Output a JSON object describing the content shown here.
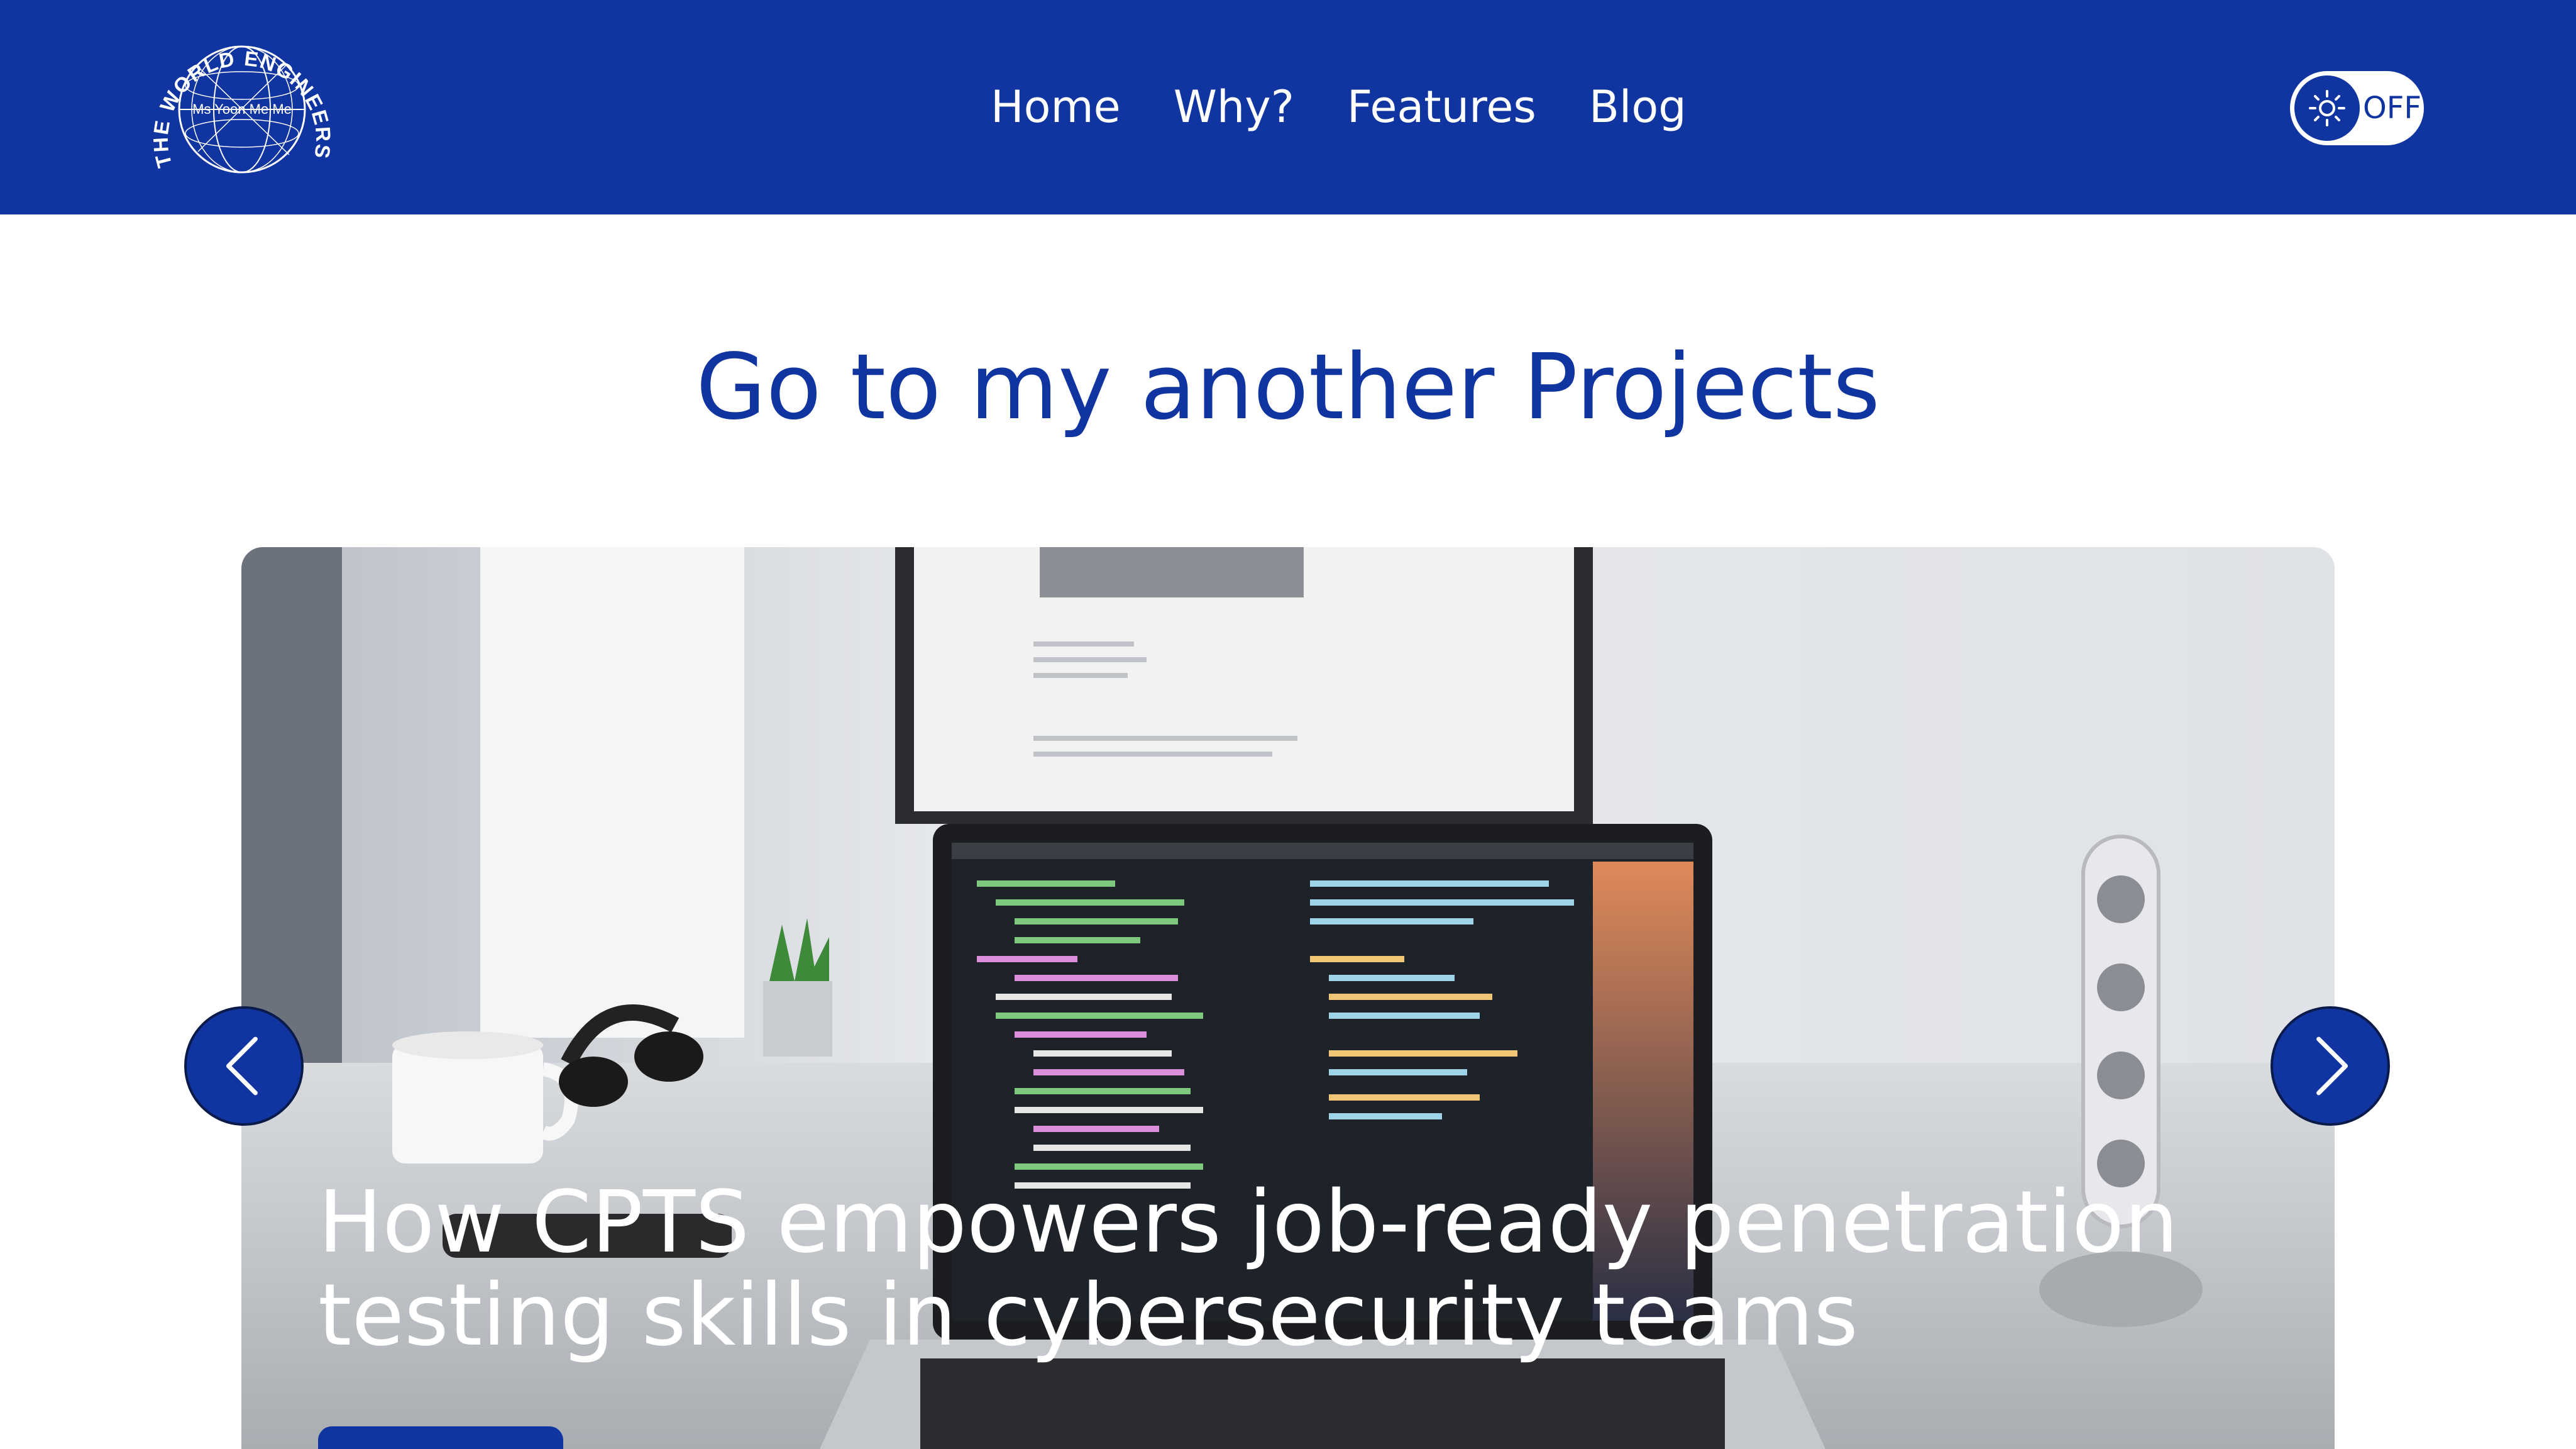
{
  "header": {
    "logo": {
      "ring_text": "THE WORLD ENGINEERS",
      "center_text": "Ms Yoon Me Me"
    },
    "nav": [
      {
        "label": "Home"
      },
      {
        "label": "Why?"
      },
      {
        "label": "Features"
      },
      {
        "label": "Blog"
      }
    ],
    "theme_toggle": {
      "state_label": "OFF",
      "icon": "sun-icon"
    }
  },
  "main": {
    "title": "Go to my another Projects",
    "carousel": {
      "slide_caption": "How CPTS empowers job-ready penetration testing skills in cybersecurity teams",
      "prev_icon": "chevron-left-icon",
      "next_icon": "chevron-right-icon"
    }
  },
  "colors": {
    "brand_blue": "#1034a0",
    "background": "#ffffff"
  }
}
